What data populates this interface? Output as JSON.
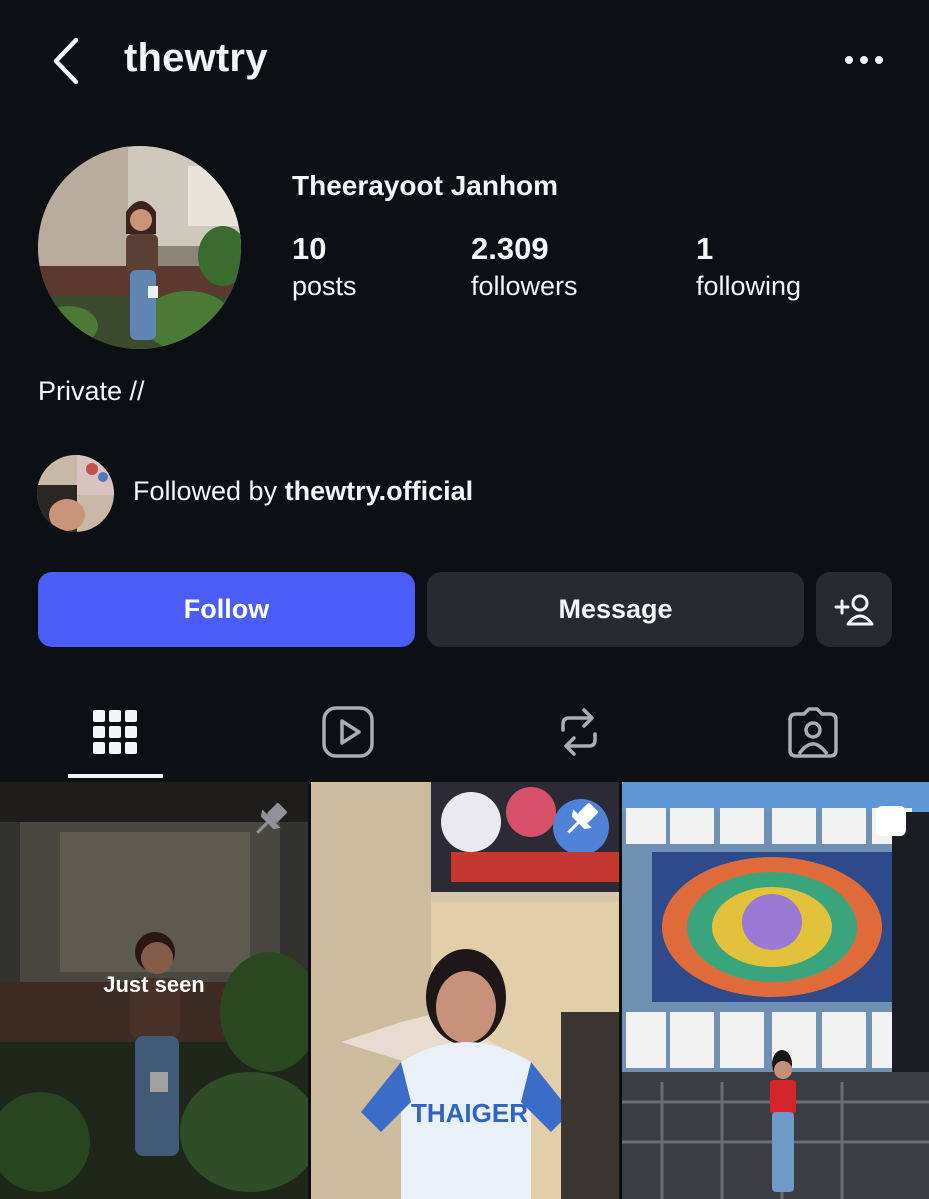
{
  "header": {
    "username": "thewtry",
    "back_icon": "chevron-left-icon",
    "more_icon": "more-horizontal-icon"
  },
  "profile": {
    "full_name": "Theerayoot Janhom",
    "stats": [
      {
        "value": "10",
        "label": "posts"
      },
      {
        "value": "2.309",
        "label": "followers"
      },
      {
        "value": "1",
        "label": "following"
      }
    ],
    "bio": "Private //"
  },
  "followed_by": {
    "prefix": "Followed by",
    "account": "thewtry.official"
  },
  "actions": {
    "follow_label": "Follow",
    "message_label": "Message",
    "add_user_icon": "add-user-icon"
  },
  "tabs": [
    {
      "icon": "grid-icon",
      "active": true
    },
    {
      "icon": "reels-icon",
      "active": false
    },
    {
      "icon": "reposts-icon",
      "active": false
    },
    {
      "icon": "tagged-icon",
      "active": false
    }
  ],
  "posts": [
    {
      "pinned": true,
      "overlay": "Just seen"
    },
    {
      "pinned": true,
      "overlay": ""
    },
    {
      "pinned": false,
      "multiple": true,
      "overlay": ""
    }
  ],
  "colors": {
    "background": "#0c0f14",
    "primary_button": "#4a5df9",
    "secondary_button": "#262a31",
    "text": "#f3f5f7"
  }
}
